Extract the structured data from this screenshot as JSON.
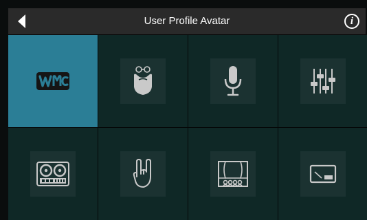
{
  "header": {
    "title": "User Profile Avatar",
    "back_icon": "back-arrow-icon",
    "info_icon": "info-icon",
    "info_glyph": "i"
  },
  "colors": {
    "header_bg": "#2a2a2a",
    "tile_bg": "#0f2826",
    "selected_bg": "#2b7e96",
    "icon_color": "#c9c9c9"
  },
  "avatars": [
    {
      "icon": "presonus-logo-icon",
      "selected": true
    },
    {
      "icon": "beard-glasses-icon",
      "selected": false
    },
    {
      "icon": "microphone-icon",
      "selected": false
    },
    {
      "icon": "mixer-faders-icon",
      "selected": false
    },
    {
      "icon": "reel-to-reel-tape-icon",
      "selected": false
    },
    {
      "icon": "rock-hand-icon",
      "selected": false
    },
    {
      "icon": "stage-audience-icon",
      "selected": false
    },
    {
      "icon": "monitor-icon",
      "selected": false
    }
  ]
}
